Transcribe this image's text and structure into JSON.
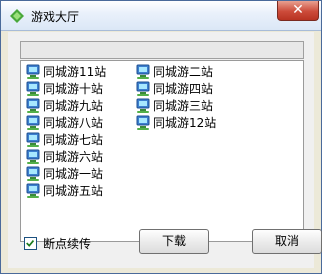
{
  "window": {
    "title": "游戏大厅",
    "close_label": "✕"
  },
  "path": {
    "value": ""
  },
  "servers": {
    "col1": [
      "同城游11站",
      "同城游十站",
      "同城游九站",
      "同城游八站",
      "同城游七站",
      "同城游六站",
      "同城游一站",
      "同城游五站"
    ],
    "col2": [
      "同城游二站",
      "同城游四站",
      "同城游三站",
      "同城游12站"
    ]
  },
  "resume": {
    "label": "断点续传",
    "checked": true
  },
  "buttons": {
    "download": "下载",
    "cancel": "取消"
  }
}
